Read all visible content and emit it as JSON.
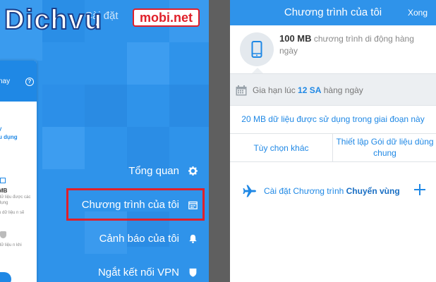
{
  "logo": {
    "main": "Dichvu",
    "badge": "mobi.net"
  },
  "left": {
    "header_title": "Cài đặt",
    "card": {
      "top_text": "nay",
      "lines": [
        "y",
        "u dụng"
      ],
      "mb_text": "MB",
      "small_a": "dữ liệu được các dụng",
      "small_b": "u dữ liệu n sẽ",
      "small_c": "dữ liệu n khi"
    },
    "menu": [
      {
        "label": "Tổng quan",
        "icon": "gear-icon"
      },
      {
        "label": "Chương trình của tôi",
        "icon": "calendar-icon"
      },
      {
        "label": "Cảnh báo của tôi",
        "icon": "bell-icon"
      },
      {
        "label": "Ngắt kết nối VPN",
        "icon": "shield-icon"
      }
    ]
  },
  "right": {
    "title": "Chương trình của tôi",
    "done_label": "Xong",
    "plan": {
      "amount": "100 MB",
      "description": "chương trình di động hàng ngày"
    },
    "renew": {
      "prefix": "Gia hạn lúc",
      "time": "12 SA",
      "suffix": "hàng ngày"
    },
    "usage_text": "20 MB dữ liệu được sử dụng trong giai đoạn này",
    "options": {
      "more": "Tùy chọn khác",
      "shared": "Thiết lập Gói dữ liệu dùng chung"
    },
    "roaming": {
      "prefix": "Cài đặt Chương trình",
      "highlight": "Chuyển vùng"
    }
  },
  "colors": {
    "primary": "#2f93ea",
    "accent_blue": "#1f88e5",
    "highlight_red": "#e0202a",
    "divider": "#5f5f5f"
  }
}
